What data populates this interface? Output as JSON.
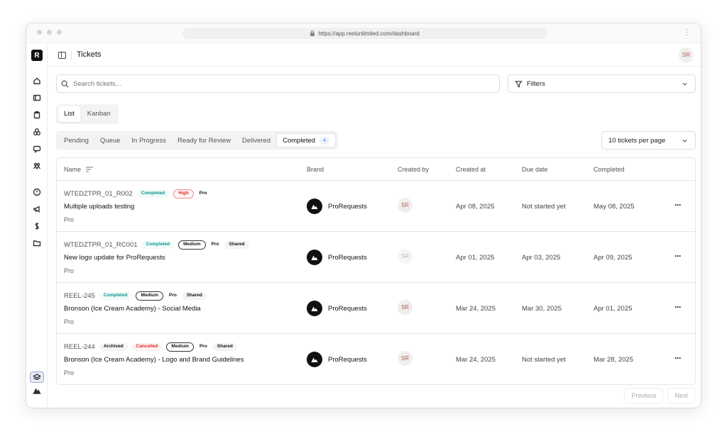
{
  "browser": {
    "url": "https://app.reelunlimited.com/dashboard"
  },
  "app": {
    "logo_letter": "R",
    "page_title": "Tickets",
    "user_initials": "SR"
  },
  "search": {
    "placeholder": "Search tickets...",
    "value": ""
  },
  "filters": {
    "label": "Filters"
  },
  "view_toggle": [
    {
      "label": "List",
      "active": true
    },
    {
      "label": "Kanban",
      "active": false
    }
  ],
  "status_tabs": [
    {
      "label": "Pending"
    },
    {
      "label": "Queue"
    },
    {
      "label": "In Progress"
    },
    {
      "label": "Ready for Review"
    },
    {
      "label": "Delivered"
    },
    {
      "label": "Completed",
      "count": "4",
      "active": true
    }
  ],
  "per_page": {
    "label": "10 tickets per page"
  },
  "table": {
    "headers": {
      "name": "Name",
      "brand": "Brand",
      "created_by": "Created by",
      "created_at": "Created at",
      "due_date": "Due date",
      "completed": "Completed"
    },
    "rows": [
      {
        "id": "WTEDZTPR_01_R002",
        "badges": [
          "Completed",
          "High",
          "Pro"
        ],
        "title": "Multiple uploads testing",
        "plan": "Pro",
        "brand": "ProRequests",
        "created_by": "SR",
        "created_at": "Apr 08, 2025",
        "due_date": "Not started yet",
        "completed": "May 08, 2025"
      },
      {
        "id": "WTEDZTPR_01_RC001",
        "badges": [
          "Completed",
          "Medium",
          "Pro",
          "Shared"
        ],
        "title": "New logo update for ProRequests",
        "plan": "Pro",
        "brand": "ProRequests",
        "created_by": "SR",
        "created_at": "Apr 01, 2025",
        "due_date": "Apr 03, 2025",
        "completed": "Apr 09, 2025"
      },
      {
        "id": "REEL-245",
        "badges": [
          "Completed",
          "Medium",
          "Pro",
          "Shared"
        ],
        "title": "Bronson (Ice Cream Academy) - Social Media",
        "plan": "Pro",
        "brand": "ProRequests",
        "created_by": "SR",
        "created_at": "Mar 24, 2025",
        "due_date": "Mar 30, 2025",
        "completed": "Apr 01, 2025"
      },
      {
        "id": "REEL-244",
        "badges": [
          "Archived",
          "Cancelled",
          "Medium",
          "Pro",
          "Shared"
        ],
        "title": "Bronson (Ice Cream Academy) - Logo and Brand Guidelines",
        "plan": "Pro",
        "brand": "ProRequests",
        "created_by": "SR",
        "created_at": "Mar 24, 2025",
        "due_date": "Not started yet",
        "completed": "Mar 28, 2025"
      }
    ]
  },
  "pagination": {
    "previous": "Previous",
    "next": "Next"
  }
}
